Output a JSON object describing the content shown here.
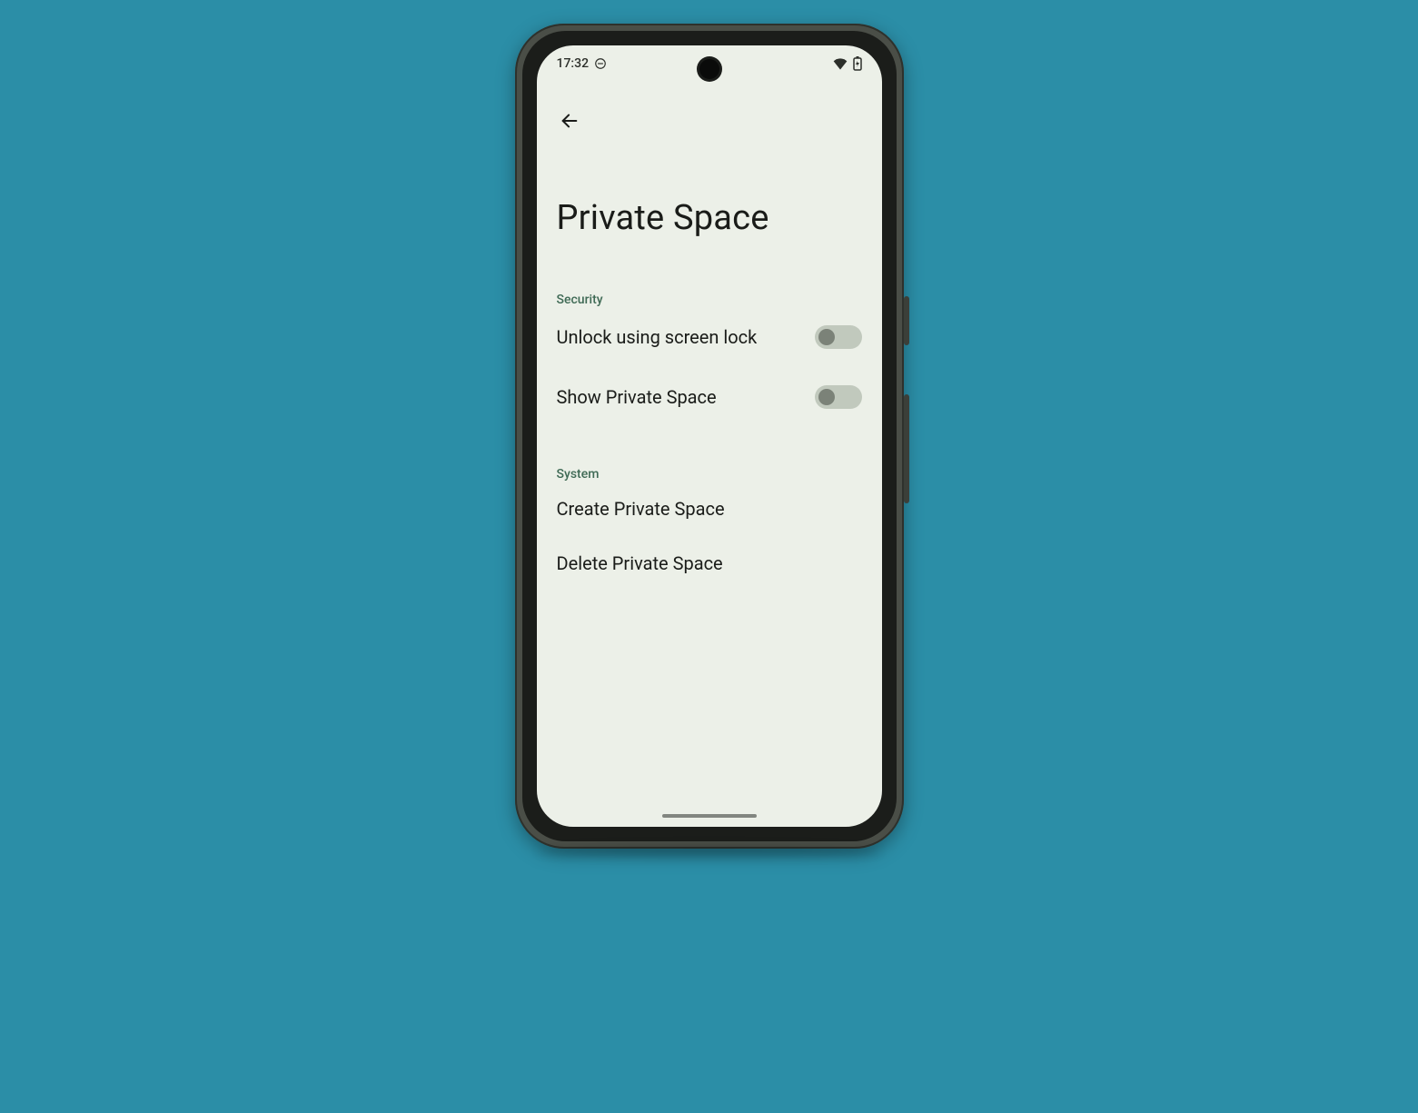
{
  "status": {
    "time": "17:32"
  },
  "page": {
    "title": "Private Space"
  },
  "sections": {
    "security": {
      "header": "Security",
      "unlock_label": "Unlock using screen lock",
      "unlock_on": false,
      "show_label": "Show Private Space",
      "show_on": false
    },
    "system": {
      "header": "System",
      "create_label": "Create Private Space",
      "delete_label": "Delete Private Space"
    }
  }
}
